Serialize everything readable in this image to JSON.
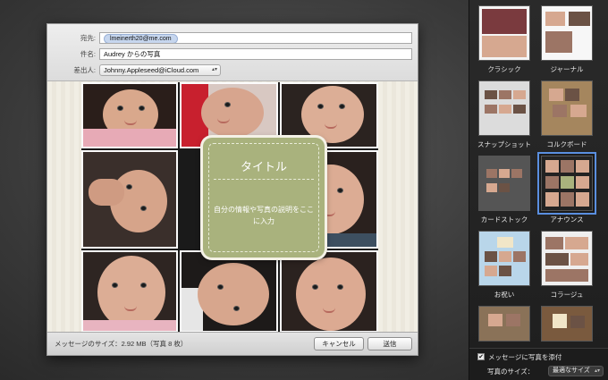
{
  "compose": {
    "to_label": "宛先:",
    "to_value": "lmeinerth20@me.com",
    "subject_label": "件名:",
    "subject_value": "Audrey からの写真",
    "from_label": "差出人:",
    "from_value": "Johnny.Appleseed@iCloud.com"
  },
  "stationery": {
    "title": "タイトル",
    "description": "自分の情報や写真の説明をここに入力"
  },
  "footer": {
    "message_size": "メッセージのサイズ：2.92 MB（写真 8 枚）",
    "cancel_label": "キャンセル",
    "send_label": "送信"
  },
  "templates": [
    {
      "label": "クラシック"
    },
    {
      "label": "ジャーナル"
    },
    {
      "label": "スナップショット"
    },
    {
      "label": "コルクボード"
    },
    {
      "label": "カードストック"
    },
    {
      "label": "アナウンス",
      "selected": true
    },
    {
      "label": "お祝い"
    },
    {
      "label": "コラージュ"
    }
  ],
  "options": {
    "attach_label": "メッセージに写真を添付",
    "attach_checked": true,
    "size_label": "写真のサイズ：",
    "size_value": "最適なサイズ"
  },
  "colors": {
    "title_card": "#a9b27d",
    "selection": "#5a8fe0",
    "token": "#c6d6ee"
  }
}
